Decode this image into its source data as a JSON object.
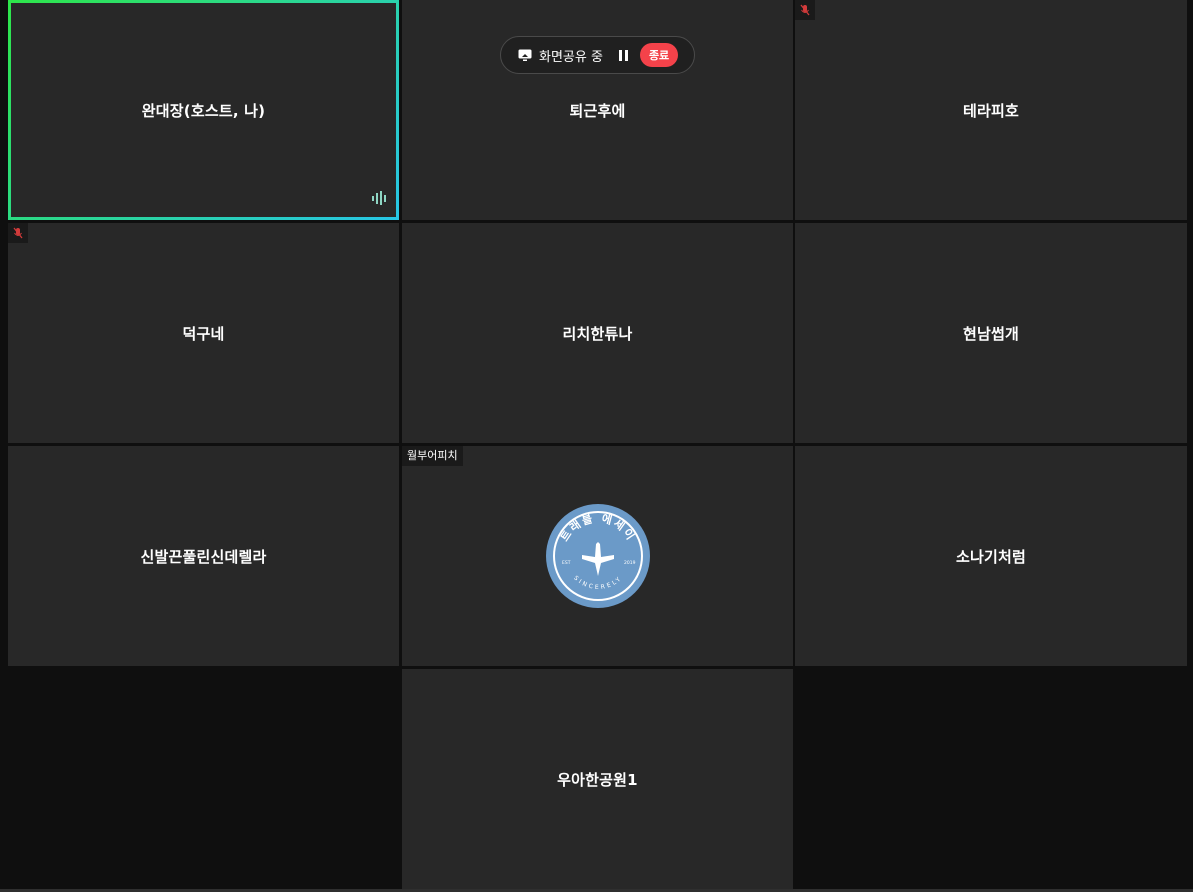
{
  "share_bar": {
    "label": "화면공유 중",
    "end_label": "종료"
  },
  "tiles": [
    {
      "name": "완대장(호스트, 나)"
    },
    {
      "name": "퇴근후에"
    },
    {
      "name": "테라피호"
    },
    {
      "name": "덕구네"
    },
    {
      "name": "리치한튜나"
    },
    {
      "name": "현남썹개"
    },
    {
      "name": "신발끈풀린신데렐라"
    },
    {
      "name": "",
      "tag": "월부어피치"
    },
    {
      "name": "소나기처럼"
    },
    {
      "name": "우아한공원1"
    }
  ],
  "avatar_logo": {
    "arc_text": "트래블 에세이",
    "bottom_text": "SINCERELY",
    "left_text": "EST",
    "right_text": "2019",
    "color": "#6b9ac8"
  },
  "colors": {
    "tile_bg": "#282828",
    "page_bg": "#0f0f0f",
    "end_red": "#f4424a",
    "active_green": "#2ee64a",
    "active_cyan": "#27c6e6",
    "muted_red": "#d23b3b"
  }
}
